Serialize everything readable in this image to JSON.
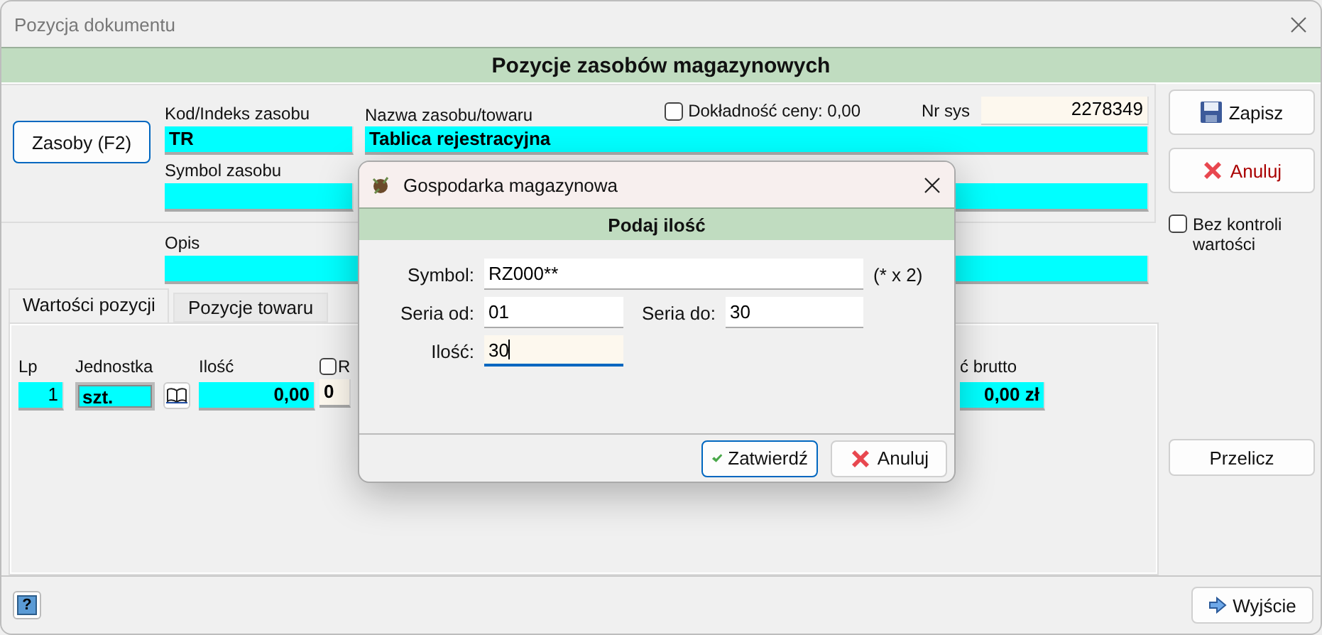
{
  "window": {
    "title": "Pozycja dokumentu"
  },
  "header": "Pozycje zasobów magazynowych",
  "resource_button": "Zasoby (F2)",
  "price_precision": {
    "label": "Dokładność ceny: 0,00",
    "checked": false
  },
  "sys_number": {
    "label": "Nr sys",
    "value": "2278349"
  },
  "code": {
    "label": "Kod/Indeks zasobu",
    "value": "TR"
  },
  "name": {
    "label": "Nazwa zasobu/towaru",
    "value": "Tablica rejestracyjna"
  },
  "symbol": {
    "label": "Symbol zasobu"
  },
  "description": {
    "label": "Opis"
  },
  "tabs": [
    {
      "label": "Wartości pozycji",
      "selected": true
    },
    {
      "label": "Pozycje towaru",
      "selected": false
    }
  ],
  "values_row": {
    "lp": {
      "label": "Lp",
      "value": "1"
    },
    "unit": {
      "label": "Jednostka",
      "value": "szt."
    },
    "quantity": {
      "label": "Ilość",
      "value": "0,00"
    },
    "column_4": {
      "label": "R",
      "checked": false,
      "value": "0"
    },
    "gross": {
      "label": "ć brutto",
      "value": "0,00 zł"
    }
  },
  "save_button": "Zapisz",
  "cancel_button": "Anuluj",
  "no_value_check": {
    "label": "Bez kontroli wartości",
    "checked": false
  },
  "recalc_button": "Przelicz",
  "help_button": "?",
  "exit_button": "Wyjście",
  "dialog": {
    "title": "Gospodarka magazynowa",
    "header": "Podaj ilość",
    "symbol": {
      "label": "Symbol:",
      "value": "RZ000**",
      "hint": "(* x 2)"
    },
    "series_from": {
      "label": "Seria od:",
      "value": "01"
    },
    "series_to": {
      "label": "Seria do:",
      "value": "30"
    },
    "quantity": {
      "label": "Ilość:",
      "value": "30",
      "focused": true
    },
    "confirm_button": "Zatwierdź",
    "cancel_button": "Anuluj"
  }
}
